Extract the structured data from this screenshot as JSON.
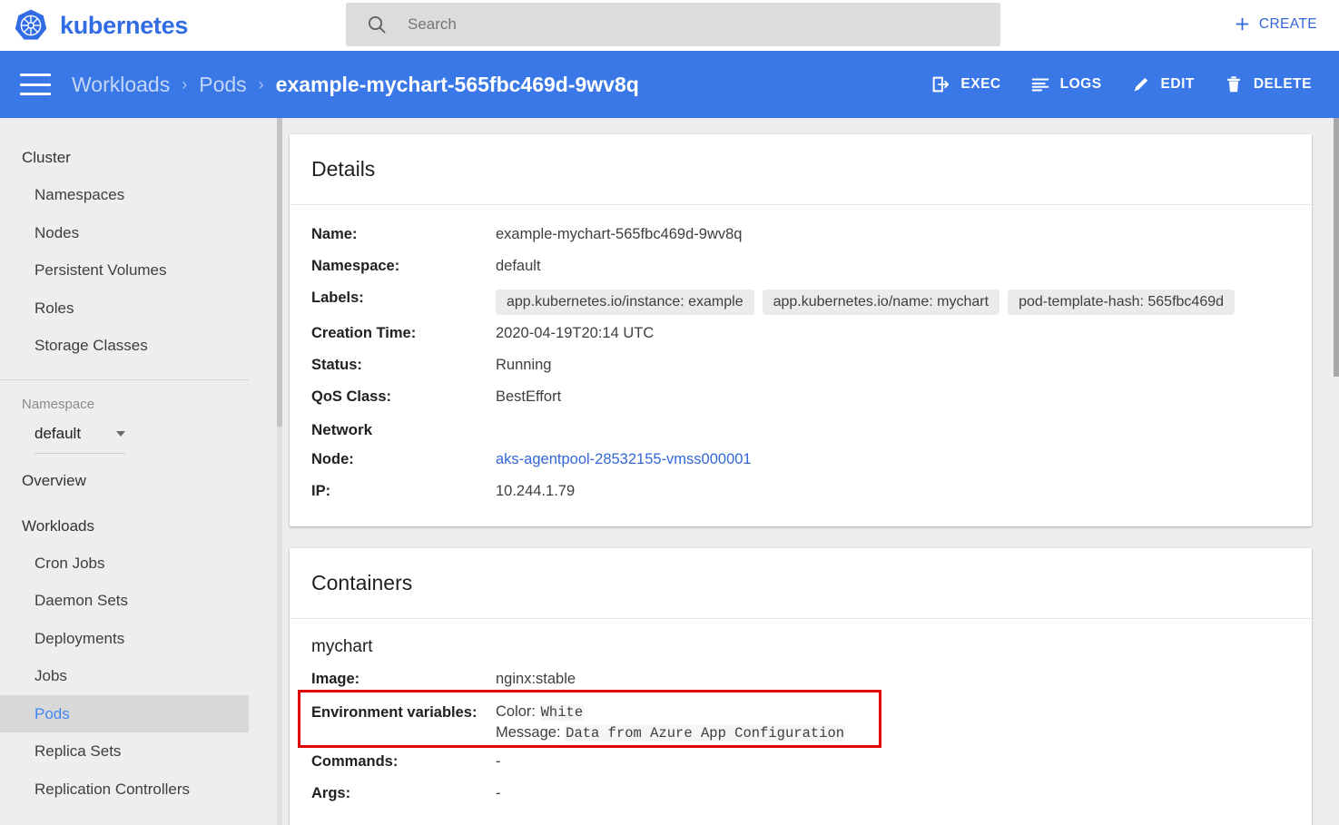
{
  "app": {
    "brand": "kubernetes",
    "logo_icon": "kubernetes-helm-wheel-logo",
    "accent_blue": "#326ce5",
    "actionbar_blue": "#3b78e7",
    "annotation_color": "#e00000"
  },
  "topbar": {
    "search": {
      "icon": "search-icon",
      "placeholder": "Search",
      "value": ""
    },
    "create_button": {
      "label": "CREATE",
      "icon": "plus-icon"
    }
  },
  "actionbar": {
    "menu_icon": "hamburger-menu-icon",
    "breadcrumb": {
      "items": [
        {
          "label": "Workloads",
          "current": false
        },
        {
          "label": "Pods",
          "current": false
        }
      ],
      "separator": "›",
      "current": "example-mychart-565fbc469d-9wv8q"
    },
    "actions": [
      {
        "label": "EXEC",
        "icon": "exec-terminal-icon"
      },
      {
        "label": "LOGS",
        "icon": "logs-lines-icon"
      },
      {
        "label": "EDIT",
        "icon": "edit-pencil-icon"
      },
      {
        "label": "DELETE",
        "icon": "delete-trash-icon"
      }
    ]
  },
  "sidebar": {
    "cluster_header": "Cluster",
    "cluster_items": [
      {
        "label": "Namespaces"
      },
      {
        "label": "Nodes"
      },
      {
        "label": "Persistent Volumes"
      },
      {
        "label": "Roles"
      },
      {
        "label": "Storage Classes"
      }
    ],
    "namespace_label": "Namespace",
    "namespace_value": "default",
    "overview_header": "Overview",
    "workloads_header": "Workloads",
    "workload_items": [
      {
        "label": "Cron Jobs",
        "selected": false
      },
      {
        "label": "Daemon Sets",
        "selected": false
      },
      {
        "label": "Deployments",
        "selected": false
      },
      {
        "label": "Jobs",
        "selected": false
      },
      {
        "label": "Pods",
        "selected": true
      },
      {
        "label": "Replica Sets",
        "selected": false
      },
      {
        "label": "Replication Controllers",
        "selected": false
      }
    ]
  },
  "details_card": {
    "title": "Details",
    "rows": [
      {
        "label": "Name:",
        "value": "example-mychart-565fbc469d-9wv8q"
      },
      {
        "label": "Namespace:",
        "value": "default"
      }
    ],
    "labels_row_label": "Labels:",
    "labels": [
      "app.kubernetes.io/instance: example",
      "app.kubernetes.io/name: mychart",
      "pod-template-hash: 565fbc469d"
    ],
    "rows2": [
      {
        "label": "Creation Time:",
        "value": "2020-04-19T20:14 UTC"
      },
      {
        "label": "Status:",
        "value": "Running"
      },
      {
        "label": "QoS Class:",
        "value": "BestEffort"
      }
    ],
    "network_header": "Network",
    "node_label": "Node:",
    "node_value": "aks-agentpool-28532155-vmss000001",
    "ip_label": "IP:",
    "ip_value": "10.244.1.79"
  },
  "containers_card": {
    "title": "Containers",
    "container_name": "mychart",
    "image_label": "Image:",
    "image_value": "nginx:stable",
    "env_label": "Environment variables:",
    "env_vars": [
      {
        "key": "Color:",
        "value": "White"
      },
      {
        "key": "Message:",
        "value": "Data from Azure App Configuration"
      }
    ],
    "commands_label": "Commands:",
    "commands_value": "-",
    "args_label": "Args:",
    "args_value": "-"
  }
}
